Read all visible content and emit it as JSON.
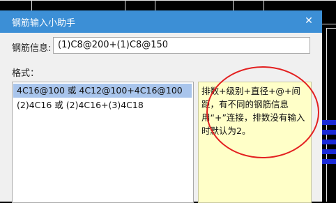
{
  "dialog": {
    "title": "钢筋输入小助手",
    "close_icon": "close-icon"
  },
  "rebar_info": {
    "label": "钢筋信息:",
    "value": "(1)C8@200+(1)C8@150"
  },
  "format": {
    "label": "格式：",
    "items": [
      {
        "text": "4C16@100 或 4C12@100+4C16@100",
        "selected": true
      },
      {
        "text": "(2)4C16 或 (2)4C16+(3)4C18",
        "selected": false
      }
    ]
  },
  "help": {
    "text": "排数+级别+直径+@+间距，有不同的钢筋信息用“+”连接，排数没有输入时默认为2。"
  },
  "colors": {
    "titlebar": "#3c8fd6",
    "selection": "#a9c5ec",
    "help_bg": "#ffffc8",
    "annotation": "#e32020"
  }
}
